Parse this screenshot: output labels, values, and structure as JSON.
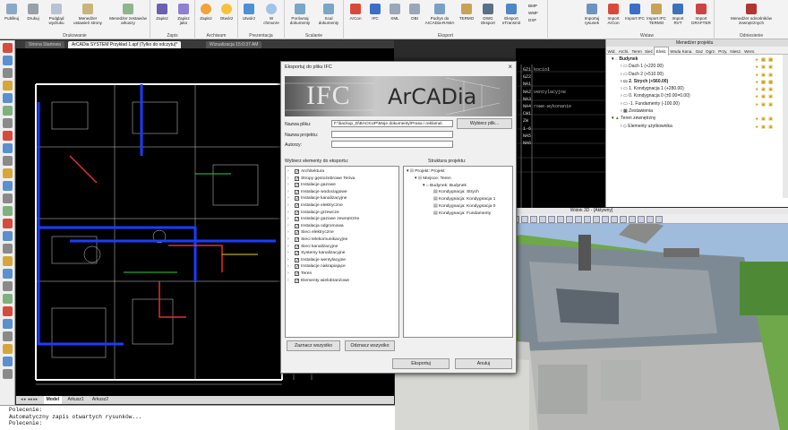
{
  "ribbon": {
    "groups": [
      {
        "label": "Drukowanie",
        "buttons": [
          "Publikuj",
          "Drukuj",
          "Podgląd wydruku",
          "Menedżer ustawień strony",
          "Menedżer zestawów arkuszy"
        ]
      },
      {
        "label": "Zapis",
        "buttons": [
          "Zapisz",
          "Zapisz jako"
        ]
      },
      {
        "label": "Archiwum",
        "buttons": [
          "Zapisz",
          "Otwórz"
        ]
      },
      {
        "label": "Prezentacja",
        "buttons": [
          "Utwórz",
          "W chmurze"
        ]
      },
      {
        "label": "Scalanie",
        "buttons": [
          "Porównaj dokumenty",
          "Scal dokumenty"
        ]
      },
      {
        "label": "Eksport",
        "buttons": [
          "ArCon",
          "IFC",
          "XML",
          "OBI",
          "Podrys do ArCADia-RAMA",
          "TERMO",
          "DWG Eksport",
          "Eksport eTransmit"
        ]
      },
      {
        "label": "Eksport",
        "small": [
          "BMP",
          "WMF",
          "DXF"
        ]
      },
      {
        "label": "Wstaw",
        "buttons": [
          "Importuj rysunek",
          "Import ArCon",
          "Import IFC",
          "Import IFC TERMO",
          "Import RVT",
          "Import DRAFTER"
        ]
      },
      {
        "label": "Odniesienie",
        "buttons": [
          "Menedżer odnośników zewnętrznych"
        ]
      }
    ]
  },
  "doc_tabs": [
    "Strona Startowa",
    "ArCADia SYSTEM Przykład 1.apf (Tylko do odczytu)*",
    "Wizualizacja 15:0:37 AM"
  ],
  "model_tabs": [
    "Model",
    "Arkusz1",
    "Arkusz2"
  ],
  "command_lines": [
    "Polecenie:",
    "Automatyczny zapis otwartych rysunków...",
    "Polecenie:"
  ],
  "dialog": {
    "title": "Eksportuj do pliku IFC",
    "banner_ifc": "IFC",
    "banner_arcadia": "ArCADia",
    "file_label": "Nazwa pliku:",
    "file_value": "F:\\backup_D\\BACKUP\\Moje dokumenty\\Prasa i reklama\\",
    "browse_button": "Wybierz plik...",
    "project_label": "Nazwa projektu:",
    "authors_label": "Autorzy:",
    "elements_label": "Wybierz elementy do eksportu:",
    "structure_label": "Struktura projektu:",
    "elements": [
      "Architektura",
      "Stropy gęstożebrowe Teriva",
      "Instalacje gazowe",
      "Instalacje wodociągowe",
      "Instalacje kanalizacyjne",
      "Instalacje elektryczne",
      "Instalacje grzewcze",
      "Instalacje gazowe zewnętrzne",
      "Instalacja odgromowa",
      "Sieci elektryczne",
      "Sieci telekomunikacyjne",
      "Sieci kanalizacyjne",
      "Systemy kanalizacyjne",
      "Instalacje wentylacyjne",
      "Instalacje nakrapiające",
      "Teren",
      "Elementy wielobranżowe"
    ],
    "structure": [
      {
        "label": "Projekt: Projekt",
        "level": 0
      },
      {
        "label": "Miejsce: Teren",
        "level": 1
      },
      {
        "label": "Budynek: Budynek",
        "level": 2
      },
      {
        "label": "Kondygnacja: Strych",
        "level": 3
      },
      {
        "label": "Kondygnacja: Kondygnacja 1",
        "level": 3
      },
      {
        "label": "Kondygnacja: Kondygnacja 0",
        "level": 3
      },
      {
        "label": "Kondygnacja: Fundamenty",
        "level": 3
      }
    ],
    "select_all": "Zaznacz wszystko",
    "deselect_all": "Odznacz wszystko",
    "export_button": "Eksportuj",
    "cancel_button": "Anuluj"
  },
  "project_manager": {
    "title": "Menedżer projektu",
    "tabs": [
      "Wid.",
      "Archi.",
      "Teren",
      "Sieć",
      "Elekt.",
      "Woda Kana.",
      "Gaz",
      "Ogrz.",
      "Przy.",
      "Niesz.",
      "Went."
    ],
    "active_tab": "Elekt.",
    "rows": [
      {
        "label": "Budynek",
        "level": 0,
        "bold": true
      },
      {
        "label": "Dach 1 (+220.00)",
        "level": 1,
        "bold": false
      },
      {
        "label": "Dach 2 (+510.00)",
        "level": 1,
        "bold": false
      },
      {
        "label": "2. Strych (+560.00)",
        "level": 1,
        "bold": true
      },
      {
        "label": "1. Kondygnacja 1 (+280.00)",
        "level": 1,
        "bold": false
      },
      {
        "label": "0. Kondygnacja 0 (±0.00=0.00)",
        "level": 1,
        "bold": false
      },
      {
        "label": "-1. Fundamenty (-100.00)",
        "level": 1,
        "bold": false
      },
      {
        "label": "Zestawienia",
        "level": 1,
        "bold": false
      },
      {
        "label": "Teren zewnętrzny",
        "level": 0,
        "bold": false
      },
      {
        "label": "Elementy użytkownika",
        "level": 1,
        "bold": false
      }
    ]
  },
  "view3d": {
    "title": "Widok 3D - [Aktywny]"
  },
  "cad_legend": [
    {
      "code": "GZ1",
      "text": "kocioł"
    },
    {
      "code": "GZ2",
      "text": ""
    },
    {
      "code": "NA1",
      "text": ""
    },
    {
      "code": "NA2",
      "text": "ventylacyjne"
    },
    {
      "code": "NA3",
      "text": ""
    },
    {
      "code": "NA4",
      "text": "rowe-wykonanie"
    },
    {
      "code": "CW1",
      "text": ""
    },
    {
      "code": "ZW",
      "text": ""
    },
    {
      "code": "1-6",
      "text": ""
    },
    {
      "code": "NA5",
      "text": ""
    },
    {
      "code": "NA6",
      "text": ""
    }
  ],
  "colors": {
    "accent": "#0a5bc4",
    "cad_bg": "#000000",
    "ribbon_bg": "#f3f3f3"
  }
}
